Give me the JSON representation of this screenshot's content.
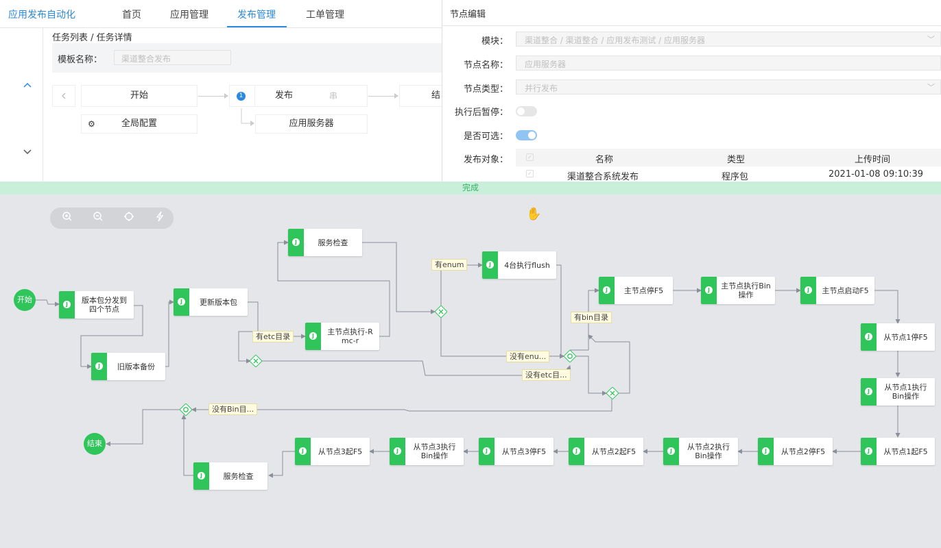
{
  "app": {
    "title": "应用发布自动化"
  },
  "nav": {
    "items": [
      "首页",
      "应用管理",
      "发布管理",
      "工单管理"
    ],
    "active_index": 2
  },
  "task": {
    "breadcrumb_list": "任务列表",
    "breadcrumb_sep": " / ",
    "breadcrumb_detail": "任务详情",
    "template_label": "模板名称：",
    "template_value": "渠道整合发布",
    "start_label": "开始",
    "publish_label": "发布",
    "publish_mode": "串",
    "publish_step": "1",
    "end_label": "结",
    "global_config_label": "全局配置",
    "app_server_label": "应用服务器"
  },
  "panel": {
    "title": "节点编辑",
    "module_label": "模块：",
    "module_value": "渠道整合 / 渠道整合 / 应用发布测试 / 应用服务器",
    "node_name_label": "节点名称：",
    "node_name_value": "应用服务器",
    "node_type_label": "节点类型：",
    "node_type_value": "并行发布",
    "pause_label": "执行后暂停：",
    "pause_on": false,
    "optional_label": "是否可选：",
    "optional_on": true,
    "target_label": "发布对象：",
    "table": {
      "headers": [
        "名称",
        "类型",
        "上传时间"
      ],
      "rows": [
        [
          "渠道整合系统发布",
          "程序包",
          "2021-01-08 09:10:39"
        ]
      ]
    }
  },
  "status": {
    "done": "完成"
  },
  "flow": {
    "start": "开始",
    "end": "结束",
    "nodes": {
      "n1": "版本包分发到四个节点",
      "n2": "旧版本备份",
      "n3": "更新版本包",
      "n4": "服务检查",
      "n5": "主节点执行-R mc-r",
      "n6": "4台执行flush",
      "n7": "主节点停F5",
      "n8": "主节点执行Bin操作",
      "n9": "主节点启动F5",
      "n10": "从节点1停F5",
      "n11": "从节点1执行Bin操作",
      "n12": "从节点1起F5",
      "n13": "从节点2停F5",
      "n14": "从节点2执行Bin操作",
      "n15": "从节点2起F5",
      "n16": "从节点3停F5",
      "n17": "从节点3执行Bin操作",
      "n18": "从节点3起F5",
      "n19": "服务检查"
    },
    "conditions": {
      "c_etc": "有etc目录",
      "c_enum": "有enum",
      "c_noenum": "没有enu...",
      "c_noetc": "没有etc目...",
      "c_bin": "有bin目录",
      "c_nobin": "没有Bin目..."
    }
  },
  "icons": {
    "zoom_in": "zoom-in-icon",
    "zoom_out": "zoom-out-icon",
    "fit": "crosshair-icon",
    "auto": "lightning-icon",
    "pan": "hand-icon"
  },
  "colors": {
    "accent": "#2a8ae0",
    "node_green": "#2fc55b",
    "done_bg": "#c9eed9"
  }
}
